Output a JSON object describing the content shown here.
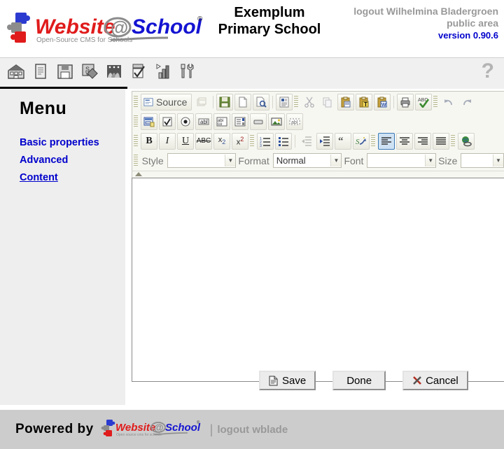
{
  "header": {
    "logo_alt": "Website@School",
    "logo_tagline": "Open-Source CMS for Schools",
    "school_line1": "Exemplum",
    "school_line2": "Primary School",
    "logout_user": "logout Wilhelmina Bladergroen",
    "area": "public area",
    "version": "version 0.90.6",
    "version_color": "#0000cc",
    "muted_color": "#999999"
  },
  "iconbar": {
    "items": [
      {
        "name": "school-icon",
        "title": "School"
      },
      {
        "name": "pages-icon",
        "title": "Pages"
      },
      {
        "name": "save-disk-icon",
        "title": "Save"
      },
      {
        "name": "modules-icon",
        "title": "Modules"
      },
      {
        "name": "users-icon",
        "title": "Users"
      },
      {
        "name": "tasks-icon",
        "title": "Tasks"
      },
      {
        "name": "statistics-icon",
        "title": "Statistics"
      },
      {
        "name": "tools-icon",
        "title": "Tools"
      }
    ],
    "help": "?"
  },
  "sidebar": {
    "title": "Menu",
    "items": [
      {
        "label": "Basic properties",
        "current": false
      },
      {
        "label": "Advanced",
        "current": false
      },
      {
        "label": "Content",
        "current": true
      }
    ],
    "link_color": "#0000cc"
  },
  "editor": {
    "source_label": "Source",
    "row1": [
      {
        "name": "templates-icon",
        "label": "Templates"
      },
      {
        "name": "save-icon",
        "label": "Save"
      },
      {
        "name": "new-page-icon",
        "label": "New Page"
      },
      {
        "name": "preview-icon",
        "label": "Preview"
      },
      {
        "name": "document-properties-icon",
        "label": "Document Properties"
      },
      {
        "name": "cut-icon",
        "label": "Cut"
      },
      {
        "name": "copy-icon",
        "label": "Copy"
      },
      {
        "name": "paste-icon",
        "label": "Paste"
      },
      {
        "name": "paste-text-icon",
        "label": "Paste as plain text"
      },
      {
        "name": "paste-word-icon",
        "label": "Paste from Word"
      },
      {
        "name": "print-icon",
        "label": "Print"
      },
      {
        "name": "spellcheck-icon",
        "label": "Check Spelling"
      },
      {
        "name": "undo-icon",
        "label": "Undo"
      },
      {
        "name": "redo-icon",
        "label": "Redo"
      }
    ],
    "row2": [
      {
        "name": "form-icon",
        "label": "Form"
      },
      {
        "name": "checkbox-icon",
        "label": "Checkbox"
      },
      {
        "name": "radio-button-icon",
        "label": "Radio Button"
      },
      {
        "name": "text-field-icon",
        "label": "Text Field"
      },
      {
        "name": "textarea-icon",
        "label": "Textarea"
      },
      {
        "name": "selection-field-icon",
        "label": "Selection Field"
      },
      {
        "name": "button-icon",
        "label": "Button"
      },
      {
        "name": "image-button-icon",
        "label": "Image Button"
      },
      {
        "name": "hidden-field-icon",
        "label": "Hidden Field"
      }
    ],
    "row3": [
      {
        "name": "bold-icon",
        "label": "Bold"
      },
      {
        "name": "italic-icon",
        "label": "Italic"
      },
      {
        "name": "underline-icon",
        "label": "Underline"
      },
      {
        "name": "strikethrough-icon",
        "label": "Strike Through"
      },
      {
        "name": "subscript-icon",
        "label": "Subscript"
      },
      {
        "name": "superscript-icon",
        "label": "Superscript"
      },
      {
        "name": "numbered-list-icon",
        "label": "Insert/Remove Numbered List"
      },
      {
        "name": "bulleted-list-icon",
        "label": "Insert/Remove Bulleted List"
      },
      {
        "name": "decrease-indent-icon",
        "label": "Decrease Indent"
      },
      {
        "name": "increase-indent-icon",
        "label": "Increase Indent"
      },
      {
        "name": "blockquote-icon",
        "label": "Block Quote"
      },
      {
        "name": "remove-format-icon",
        "label": "Remove Format"
      },
      {
        "name": "align-left-icon",
        "label": "Align Left"
      },
      {
        "name": "align-center-icon",
        "label": "Center"
      },
      {
        "name": "align-right-icon",
        "label": "Align Right"
      },
      {
        "name": "justify-icon",
        "label": "Justify"
      },
      {
        "name": "link-icon",
        "label": "Link"
      }
    ],
    "row4": {
      "style_label": "Style",
      "style_value": "",
      "format_label": "Format",
      "format_value": "Normal",
      "font_label": "Font",
      "font_value": "",
      "size_label": "Size",
      "size_value": ""
    },
    "body_text": ""
  },
  "actions": {
    "save": "Save",
    "done": "Done",
    "cancel": "Cancel"
  },
  "footer": {
    "powered_by": "Powered by",
    "logo_alt": "Website@School",
    "separator": "|",
    "logout": "logout wblade"
  }
}
